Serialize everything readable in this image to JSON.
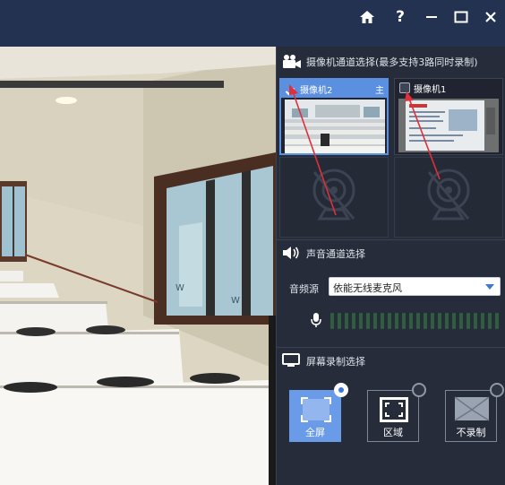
{
  "title_bar": {
    "help_label": "?",
    "icons": [
      "home-icon",
      "help-icon",
      "minimize-icon",
      "maximize-icon",
      "close-icon"
    ]
  },
  "camera_section": {
    "title": "摄像机通道选择(最多支持3路同时录制)",
    "cameras": [
      {
        "name": "摄像机2",
        "selected": true,
        "main_label": "主"
      },
      {
        "name": "摄像机1",
        "selected": false,
        "main_label": ""
      }
    ]
  },
  "audio_section": {
    "title": "声音通道选择",
    "source_label": "音频源",
    "source_value": "依能无线麦克风",
    "level_bars": 24
  },
  "screen_section": {
    "title": "屏幕录制选择",
    "options": [
      {
        "label": "全屏",
        "selected": true
      },
      {
        "label": "区域",
        "selected": false
      },
      {
        "label": "不录制",
        "selected": false
      }
    ]
  },
  "colors": {
    "title_bar": "#233250",
    "panel_bg": "#262c3a",
    "accent": "#5b8fe0",
    "arrow_annotation": "#e0303a"
  }
}
